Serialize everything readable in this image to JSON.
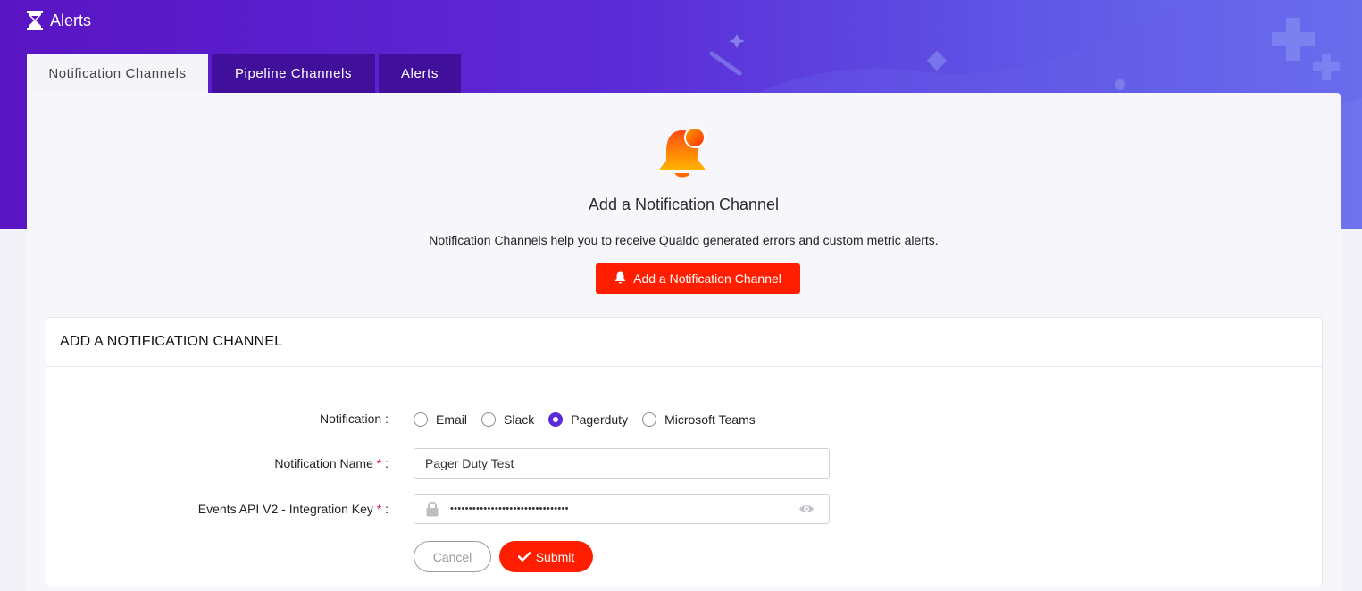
{
  "app": {
    "title": "Alerts",
    "icon": "hourglass-icon"
  },
  "tabs": [
    {
      "label": "Notification Channels",
      "active": true
    },
    {
      "label": "Pipeline Channels",
      "active": false
    },
    {
      "label": "Alerts",
      "active": false
    }
  ],
  "empty_state": {
    "icon": "bell-icon",
    "title": "Add a Notification Channel",
    "description": "Notification Channels help you to receive Qualdo generated errors and custom metric alerts.",
    "button_label": "Add a Notification Channel"
  },
  "form": {
    "header": "ADD A NOTIFICATION CHANNEL",
    "notification_label": "Notification :",
    "options": [
      {
        "label": "Email",
        "selected": false
      },
      {
        "label": "Slack",
        "selected": false
      },
      {
        "label": "Pagerduty",
        "selected": true
      },
      {
        "label": "Microsoft Teams",
        "selected": false
      }
    ],
    "name_label": "Notification Name",
    "name_value": "Pager Duty Test",
    "key_label": "Events API V2 - Integration Key",
    "key_value": "••••••••••••••••••••••••••••••••",
    "required_mark": "*",
    "label_suffix": ":",
    "cancel_label": "Cancel",
    "submit_label": "Submit"
  },
  "colors": {
    "brand_purple": "#5b2bd6",
    "accent_red": "#ff1e00",
    "tab_dark": "#41109a"
  }
}
